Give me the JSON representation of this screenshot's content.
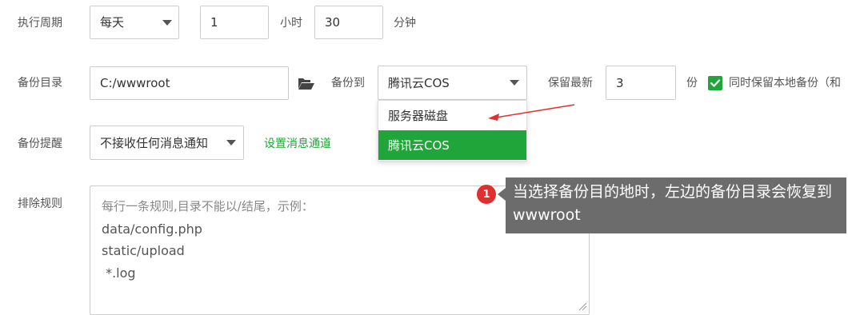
{
  "schedule": {
    "label": "执行周期",
    "period": "每天",
    "hours": "1",
    "hours_unit": "小时",
    "minutes": "30",
    "minutes_unit": "分钟"
  },
  "backup": {
    "dir_label": "备份目录",
    "dir_value": "C:/wwwroot",
    "to_label": "备份到",
    "to_value": "腾讯云COS",
    "keep_label": "保留最新",
    "keep_value": "3",
    "keep_unit": "份",
    "keep_local_label": "同时保留本地备份（和",
    "keep_local_checked": true,
    "options": [
      {
        "label": "服务器磁盘",
        "selected": false
      },
      {
        "label": "腾讯云COS",
        "selected": true
      }
    ]
  },
  "notify": {
    "label": "备份提醒",
    "value": "不接收任何消息通知",
    "settings_link": "设置消息通道"
  },
  "exclude": {
    "label": "排除规则",
    "placeholder": "每行一条规则,目录不能以/结尾，示例：",
    "lines": [
      "data/config.php",
      "static/upload",
      " *.log"
    ]
  },
  "tooltip": {
    "badge": "1",
    "text": "当选择备份目的地时，左边的备份目录会恢复到wwwroot"
  },
  "colors": {
    "accent": "#20a53a",
    "badge": "#e02f2f",
    "tooltip_bg": "#6c6c6c",
    "arrow": "#e02f2f"
  }
}
